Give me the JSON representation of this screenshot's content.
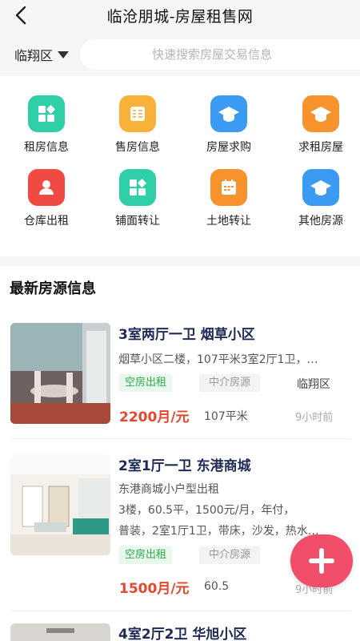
{
  "header": {
    "title": "临沧朋城-房屋租售网",
    "region": "临翔区",
    "search_placeholder": "快速搜索房屋交易信息"
  },
  "categories": [
    {
      "label": "租房信息",
      "icon": "grid-icon",
      "color": "#2fd0a8"
    },
    {
      "label": "售房信息",
      "icon": "calculator-icon",
      "color": "#f8b23a"
    },
    {
      "label": "房屋求购",
      "icon": "graduation-cap-icon",
      "color": "#3b9af2"
    },
    {
      "label": "求租房屋",
      "icon": "graduation-cap-icon",
      "color": "#f7932d"
    },
    {
      "label": "仓库出租",
      "icon": "user-icon",
      "color": "#f04a43"
    },
    {
      "label": "铺面转让",
      "icon": "grid-icon",
      "color": "#2fd0a8"
    },
    {
      "label": "土地转让",
      "icon": "calendar-icon",
      "color": "#f7932d"
    },
    {
      "label": "其他房源",
      "icon": "graduation-cap-icon",
      "color": "#3b9af2"
    }
  ],
  "section": {
    "title": "最新房源信息"
  },
  "listings": [
    {
      "title": "3室两厅一卫 烟草小区",
      "desc": [
        "烟草小区二楼，107平米3室2厅1卫，…"
      ],
      "tag_status": "空房出租",
      "tag_type": "中介房源",
      "area": "临翔区",
      "price": "2200月/元",
      "size": "107平米",
      "time": "9小时前"
    },
    {
      "title": "2室1厅一卫 东港商城",
      "desc": [
        "东港商城小户型出租",
        "3楼，60.5平，1500元/月，年付，",
        "普装，2室1厅1卫，带床，沙发，热水…"
      ],
      "tag_status": "空房出租",
      "tag_type": "中介房源",
      "area": "",
      "price": "1500月/元",
      "size": "60.5",
      "time": "9小时前"
    },
    {
      "title": "4室2厅2卫 华旭小区"
    }
  ],
  "colors": {
    "price": "#e4472c",
    "title": "#1e2a55",
    "tag_green": "#2eaa4c",
    "fab": "#f04e6a"
  },
  "fab": {
    "icon": "plus-icon"
  }
}
